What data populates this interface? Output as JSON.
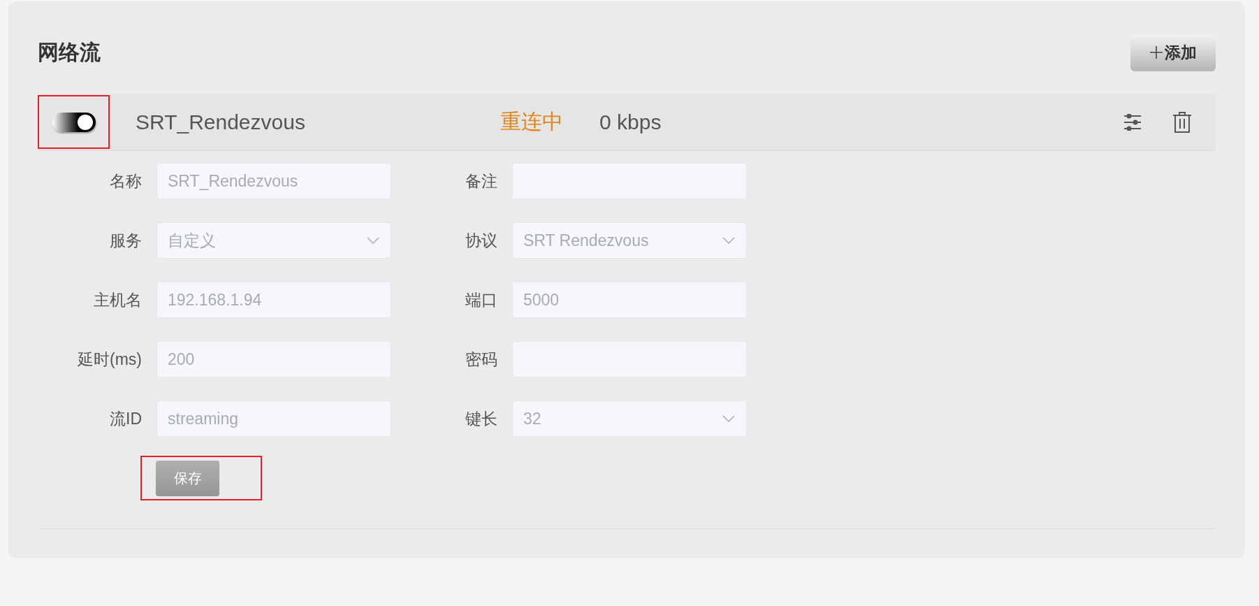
{
  "section": {
    "title": "网络流",
    "add_button": {
      "label": "添加"
    }
  },
  "streams": [
    {
      "enabled": true,
      "highlighted": true,
      "name": "SRT_Rendezvous",
      "status": "重连中",
      "bitrate": "0 kbps",
      "form": {
        "rows": [
          [
            {
              "label": "名称",
              "kind": "text",
              "value": "SRT_Rendezvous",
              "disabled": true
            },
            {
              "label": "备注",
              "kind": "text"
            }
          ],
          [
            {
              "label": "服务",
              "kind": "select",
              "value": "自定义",
              "disabled": true
            },
            {
              "label": "协议",
              "kind": "select",
              "value": "SRT Rendezvous",
              "disabled": true
            }
          ],
          [
            {
              "label": "主机名",
              "kind": "text",
              "value": "192.168.1.94",
              "disabled": true
            },
            {
              "label": "端口",
              "kind": "text",
              "value": "5000",
              "disabled": true
            }
          ],
          [
            {
              "label": "延时(ms)",
              "kind": "text",
              "value": "200",
              "disabled": true
            },
            {
              "label": "密码",
              "kind": "text"
            }
          ],
          [
            {
              "label": "流ID",
              "kind": "text",
              "value": "streaming",
              "disabled": true
            },
            {
              "label": "键长",
              "kind": "select",
              "value": "32",
              "disabled": true
            }
          ]
        ],
        "save_button": {
          "label": "保存",
          "highlighted": true
        }
      }
    }
  ]
}
